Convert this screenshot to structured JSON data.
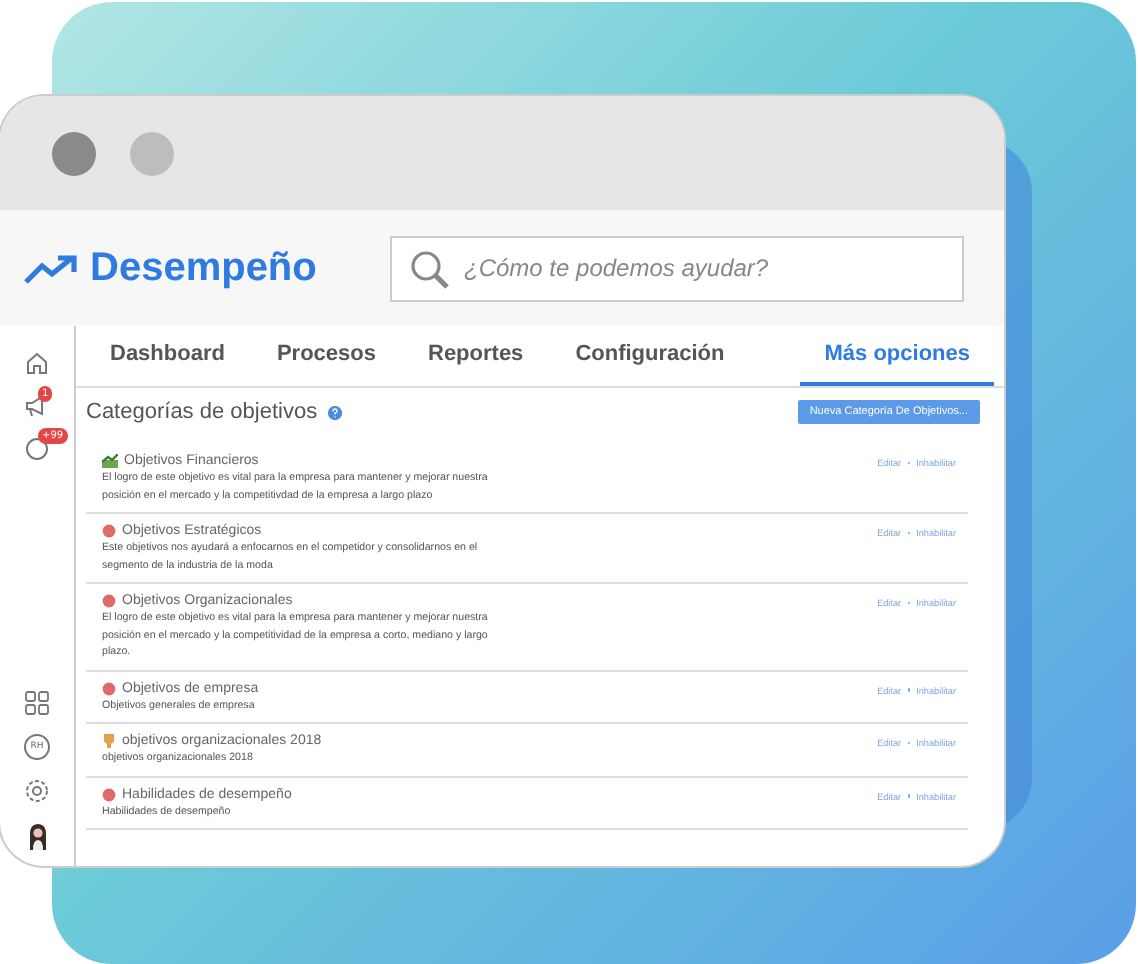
{
  "app": {
    "title": "Desempeño"
  },
  "search": {
    "placeholder": "¿Cómo te podemos ayudar?"
  },
  "tabs": [
    {
      "label": "Dashboard",
      "selected": false
    },
    {
      "label": "Procesos",
      "selected": false
    },
    {
      "label": "Reportes",
      "selected": false
    },
    {
      "label": "Configuración",
      "selected": false
    },
    {
      "label": "Más opciones",
      "selected": true
    }
  ],
  "sidebar": {
    "top": [
      {
        "kind": "home"
      },
      {
        "kind": "megaphone",
        "badge": "1"
      },
      {
        "kind": "bell",
        "badge": "+99"
      }
    ],
    "bottom": [
      {
        "kind": "grid"
      },
      {
        "kind": "rh",
        "label": "RH"
      },
      {
        "kind": "gear"
      },
      {
        "kind": "avatar"
      }
    ]
  },
  "page": {
    "heading": "Categorías de objetivos",
    "button": "Nueva Categoría De Objetivos..."
  },
  "categories": [
    {
      "kind": "chart",
      "title": "Objetivos Financieros",
      "description": "El logro de este objetivo es vital para la empresa para mantener y mejorar nuestra posición en el mercado y la competitivdad de la empresa a largo plazo",
      "actions": [
        "Editar",
        "Inhabilitar"
      ]
    },
    {
      "kind": "dot",
      "title": "Objetivos Estratégicos",
      "description": "Este objetivos nos ayudará a enfocarnos en el competidor y consolidarnos en el segmento de la industria de la moda",
      "actions": [
        "Editar",
        "Inhabilitar"
      ]
    },
    {
      "kind": "dot",
      "title": "Objetivos Organizacionales",
      "description": "El logro de este objetivo es vital para la empresa para mantener y mejorar nuestra posición en el mercado y la competitividad de la empresa a corto, mediano y largo plazo.",
      "actions": [
        "Editar",
        "Inhabilitar"
      ]
    },
    {
      "kind": "dot",
      "title": "Objetivos de empresa",
      "description": "Objetivos generales de empresa",
      "actions": [
        "Editar",
        "Inhabilitar"
      ]
    },
    {
      "kind": "trophy",
      "title": "objetivos organizacionales 2018",
      "description": "objetivos organizacionales 2018",
      "actions": [
        "Editar",
        "Inhabilitar"
      ]
    },
    {
      "kind": "dot",
      "title": "Habilidades de desempeño",
      "description": "Habilidades de desempeño",
      "actions": [
        "Editar",
        "Inhabilitar"
      ]
    }
  ]
}
